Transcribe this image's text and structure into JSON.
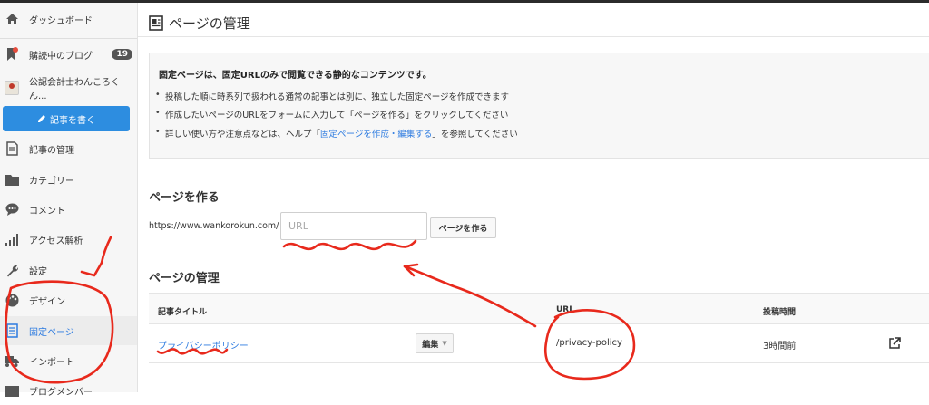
{
  "sidebar": {
    "items": [
      {
        "label": "ダッシュボード",
        "icon": "home-icon"
      },
      {
        "label": "購読中のブログ",
        "icon": "bookmark-icon",
        "badge": "19"
      },
      {
        "label": "公認会計士わんころくん...",
        "icon": "blog-avatar"
      },
      {
        "label": "記事の管理",
        "icon": "document-icon"
      },
      {
        "label": "カテゴリー",
        "icon": "folder-icon"
      },
      {
        "label": "コメント",
        "icon": "comment-icon"
      },
      {
        "label": "アクセス解析",
        "icon": "bar-chart-icon"
      },
      {
        "label": "設定",
        "icon": "wrench-icon"
      },
      {
        "label": "デザイン",
        "icon": "palette-icon"
      },
      {
        "label": "固定ページ",
        "icon": "page-icon",
        "active": true
      },
      {
        "label": "インポート",
        "icon": "truck-icon"
      },
      {
        "label": "ブログメンバー",
        "icon": "members-icon"
      }
    ],
    "write_button": "記事を書く"
  },
  "header": {
    "title": "ページの管理"
  },
  "info": {
    "heading": "固定ページは、固定URLのみで閲覧できる静的なコンテンツです。",
    "bullet1": "投稿した順に時系列で扱われる通常の記事とは別に、独立した固定ページを作成できます",
    "bullet2": "作成したいページのURLをフォームに入力して「ページを作る」をクリックしてください",
    "bullet3_pre": "詳しい使い方や注意点などは、ヘルプ「",
    "bullet3_link": "固定ページを作成・編集する",
    "bullet3_post": "」を参照してください"
  },
  "create": {
    "section_title": "ページを作る",
    "url_prefix": "https://www.wankorokun.com/",
    "input_placeholder": "URL",
    "input_value": "",
    "button": "ページを作る"
  },
  "manage": {
    "section_title": "ページの管理",
    "columns": {
      "title": "記事タイトル",
      "url": "URL",
      "time": "投稿時間"
    },
    "rows": [
      {
        "title": "プライバシーポリシー",
        "edit": "編集",
        "url": "/privacy-policy",
        "time": "3時間前"
      }
    ]
  },
  "colors": {
    "accent": "#2d8de0",
    "link": "#2d7be0",
    "annotation": "#e8291c"
  }
}
